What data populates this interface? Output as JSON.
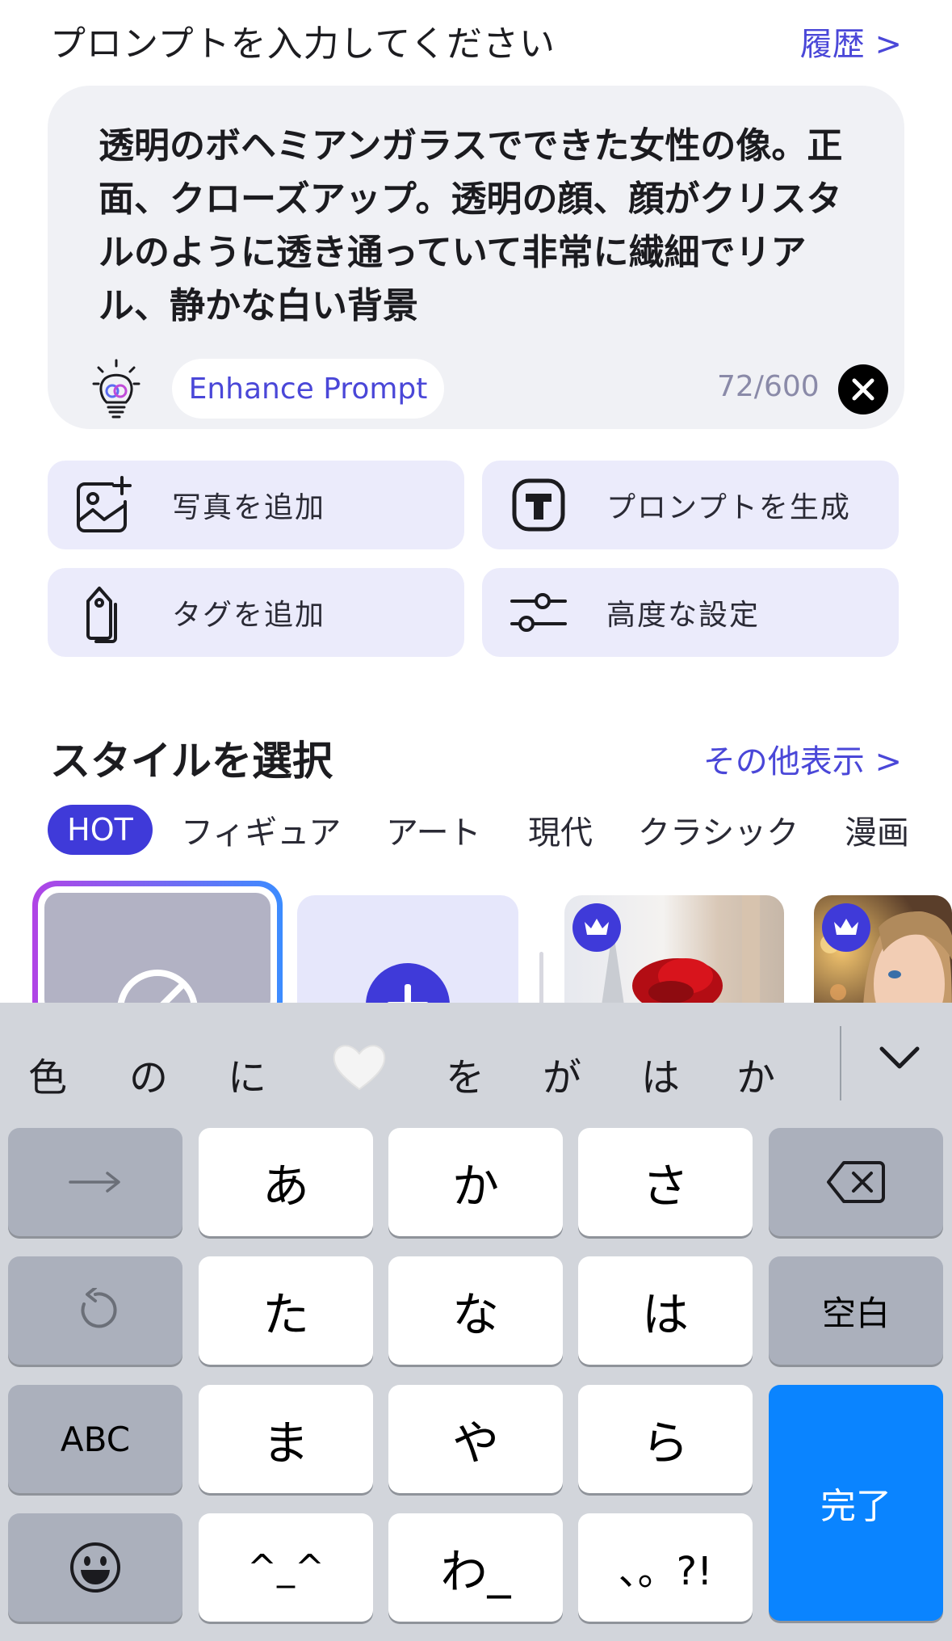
{
  "header": {
    "title": "プロンプトを入力してください",
    "history_link": "履歴 >"
  },
  "prompt": {
    "text": "透明のボヘミアンガラスでできた女性の像。正面、クローズアップ。透明の顔、顔がクリスタルのように透き通っていて非常に繊細でリアル、静かな白い背景",
    "enhance_label": "Enhance Prompt",
    "char_count": "72/600"
  },
  "actions": {
    "add_photo": "写真を追加",
    "generate_prompt": "プロンプトを生成",
    "add_tag": "タグを追加",
    "advanced_settings": "高度な設定"
  },
  "styles": {
    "title": "スタイルを選択",
    "more_link": "その他表示 >",
    "tabs": [
      "HOT",
      "フィギュア",
      "アート",
      "現代",
      "クラシック",
      "漫画"
    ]
  },
  "keyboard": {
    "candidates": [
      "色",
      "の",
      "に",
      "を",
      "が",
      "は",
      "か"
    ],
    "keys": {
      "arrow": "→",
      "a": "あ",
      "ka": "か",
      "sa": "さ",
      "ta": "た",
      "na": "な",
      "ha": "は",
      "abc": "ABC",
      "ma": "ま",
      "ya": "や",
      "ra": "ら",
      "emoticon": "^_^",
      "wa": "わ_",
      "punct": "、。?!",
      "space": "空白",
      "done": "完了"
    }
  },
  "colors": {
    "accent": "#3f3ad9",
    "link": "#4a47d8",
    "keyboard_bg": "#d2d5db",
    "done_key": "#0a84ff"
  }
}
